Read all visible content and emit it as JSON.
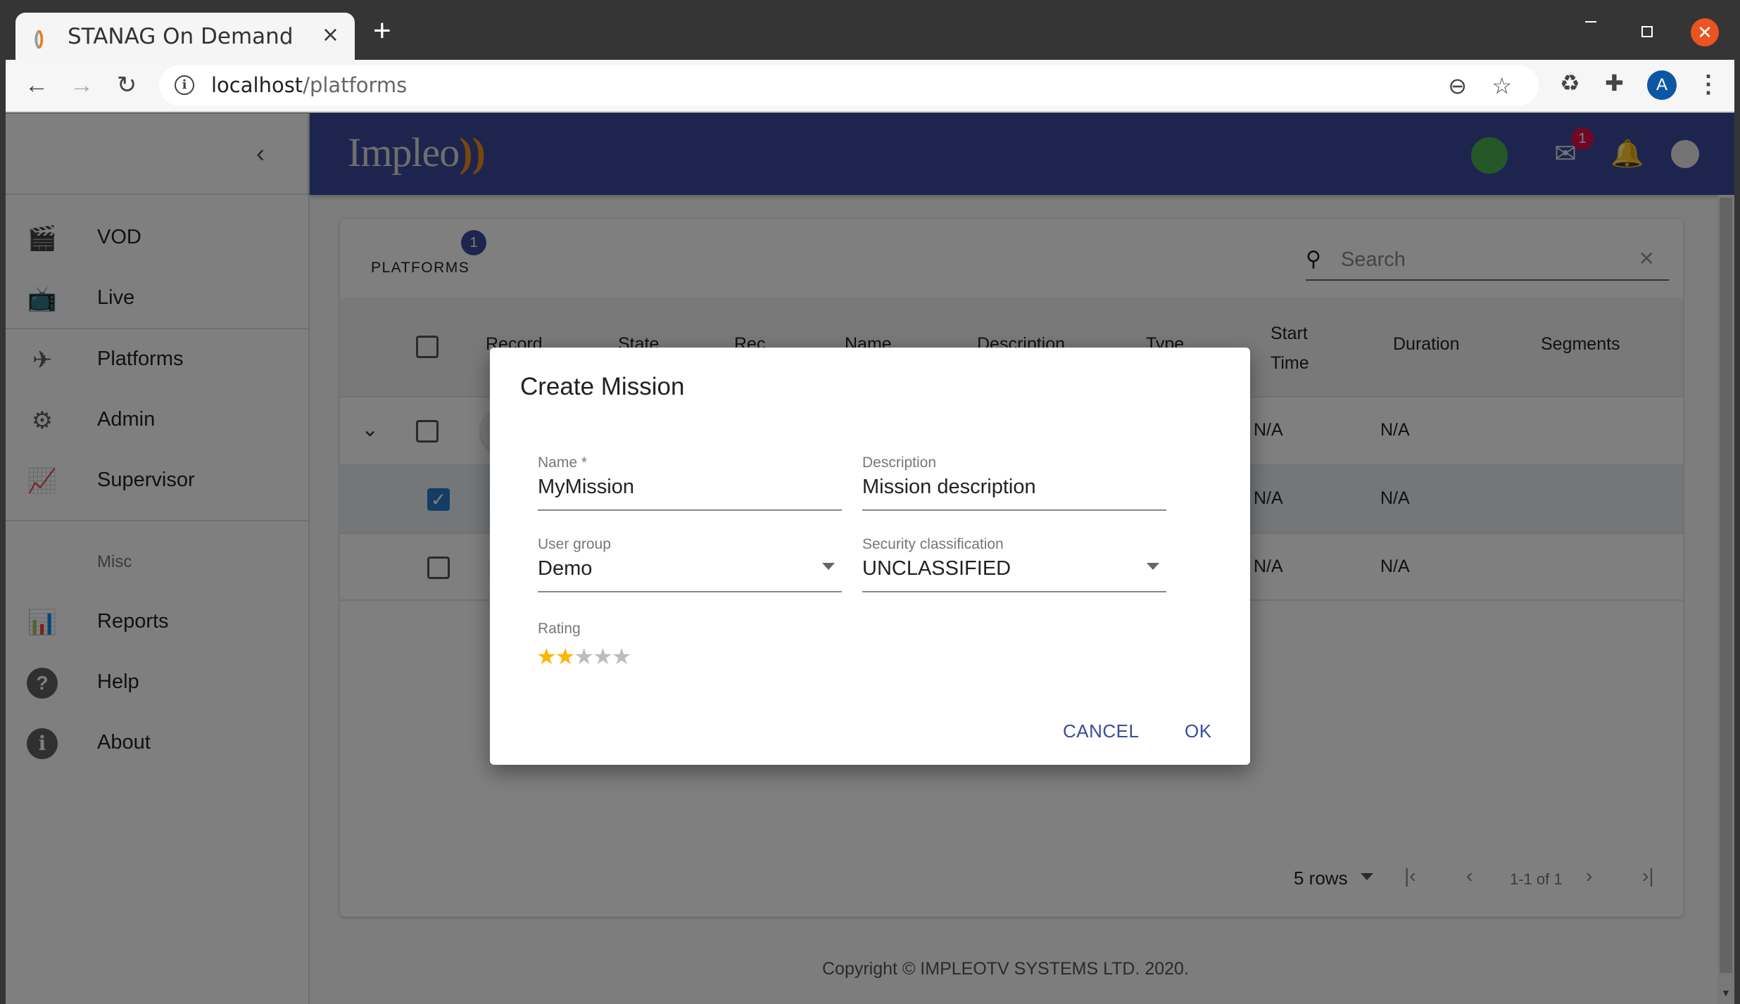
{
  "browser": {
    "tab_title": "STANAG On Demand",
    "tab_close": "×",
    "new_tab": "+",
    "url_host": "localhost",
    "url_path": "/platforms",
    "profile_initial": "A",
    "icons": {
      "back": "←",
      "forward": "→",
      "reload": "↻",
      "info": "i",
      "zoom_out": "⊖",
      "star": "☆",
      "recycle": "♻",
      "puzzle": "✚",
      "menu": "⋮",
      "close_window": "✕"
    }
  },
  "app": {
    "logo_text": "Impleo",
    "logo_arc": "))",
    "mail_badge": "1",
    "status_color": "#4caf50",
    "accent_color": "#3b4a9c"
  },
  "sidebar": {
    "collapse_icon": "‹",
    "items": [
      {
        "label": "VOD",
        "icon": "🎬"
      },
      {
        "label": "Live",
        "icon": "📺"
      },
      {
        "label": "Platforms",
        "icon": "✈"
      },
      {
        "label": "Admin",
        "icon": "⚙"
      },
      {
        "label": "Supervisor",
        "icon": "📈"
      }
    ],
    "misc_header": "Misc",
    "misc_items": [
      {
        "label": "Reports",
        "icon": "📊"
      },
      {
        "label": "Help",
        "icon": "?"
      },
      {
        "label": "About",
        "icon": "i"
      }
    ]
  },
  "platforms": {
    "title": "PLATFORMS",
    "badge": "1",
    "search_placeholder": "Search",
    "search_value": "",
    "columns": [
      "Record",
      "State",
      "Rec",
      "Name",
      "Description",
      "Type",
      "Start Time",
      "Duration",
      "Segments"
    ],
    "column_start_line1": "Start",
    "column_start_line2": "Time",
    "rows": [
      {
        "selected": false,
        "expandable": true,
        "recording": true,
        "start_time": "N/A",
        "duration": "N/A",
        "segments": ""
      },
      {
        "selected": true,
        "expandable": false,
        "recording": false,
        "start_time": "N/A",
        "duration": "N/A",
        "segments": ""
      },
      {
        "selected": false,
        "expandable": false,
        "recording": false,
        "start_time": "N/A",
        "duration": "N/A",
        "segments": ""
      }
    ],
    "pagination": {
      "rows_per_page": "5 rows",
      "range": "1-1 of 1",
      "first": "|‹",
      "prev": "‹",
      "next": "›",
      "last": "›|"
    }
  },
  "footer": "Copyright © IMPLEOTV SYSTEMS LTD. 2020.",
  "dialog": {
    "title": "Create Mission",
    "name_label": "Name *",
    "name_value": "MyMission",
    "description_label": "Description",
    "description_value": "Mission description",
    "user_group_label": "User group",
    "user_group_value": "Demo",
    "security_label": "Security classification",
    "security_value": "UNCLASSIFIED",
    "rating_label": "Rating",
    "rating_value": 2,
    "rating_max": 5,
    "star_glyph": "★",
    "cancel_label": "CANCEL",
    "ok_label": "OK"
  }
}
